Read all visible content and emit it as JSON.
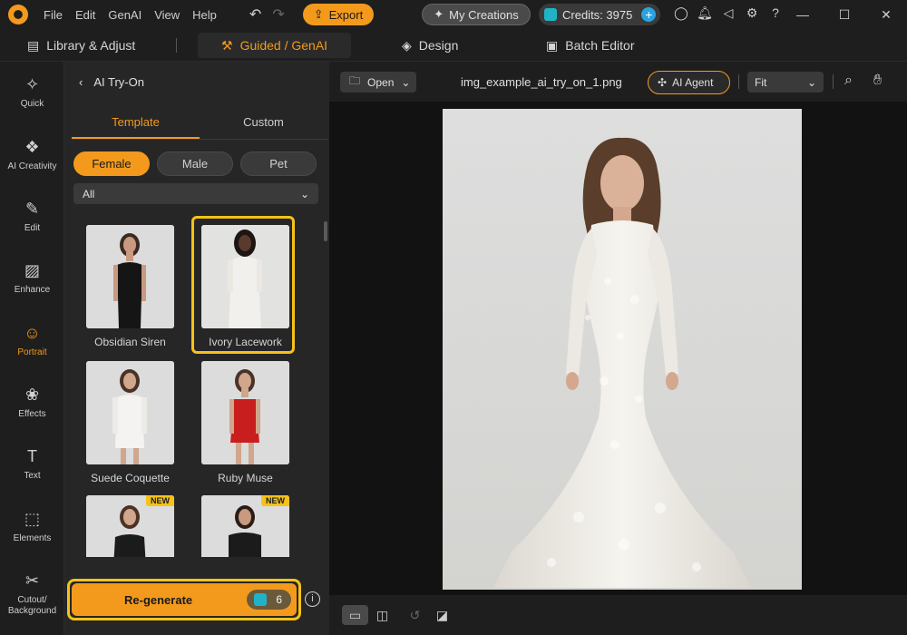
{
  "menu": [
    "File",
    "Edit",
    "GenAI",
    "View",
    "Help"
  ],
  "export_label": "Export",
  "my_creations_label": "My Creations",
  "credits_label": "Credits: 3975",
  "modes": {
    "library": "Library & Adjust",
    "guided": "Guided / GenAI",
    "design": "Design",
    "batch": "Batch Editor"
  },
  "rail": [
    {
      "label": "Quick"
    },
    {
      "label": "AI Creativity"
    },
    {
      "label": "Edit"
    },
    {
      "label": "Enhance"
    },
    {
      "label": "Portrait"
    },
    {
      "label": "Effects"
    },
    {
      "label": "Text"
    },
    {
      "label": "Elements"
    },
    {
      "label": "Cutout/\nBackground"
    }
  ],
  "panel": {
    "title": "AI Try-On",
    "tabs": [
      "Template",
      "Custom"
    ],
    "segments": [
      "Female",
      "Male",
      "Pet"
    ],
    "filter_value": "All",
    "templates": [
      {
        "label": "Obsidian Siren",
        "dress_color": "#151515"
      },
      {
        "label": "Ivory Lacework",
        "dress_color": "#f2f0ec"
      },
      {
        "label": "Suede Coquette",
        "dress_color": "#f4f3f1"
      },
      {
        "label": "Ruby Muse",
        "dress_color": "#c81e1e"
      },
      {
        "label": "",
        "badge": "NEW",
        "dress_color": "#1b1b1b"
      },
      {
        "label": "",
        "badge": "NEW",
        "dress_color": "#1b1b1b"
      }
    ],
    "regen_label": "Re-generate",
    "regen_cost": "6"
  },
  "canvas": {
    "open_label": "Open",
    "filename": "img_example_ai_try_on_1.png",
    "agent_label": "AI Agent",
    "zoom_value": "Fit"
  },
  "colors": {
    "accent": "#f39a1d",
    "highlight": "#f5c21a"
  }
}
